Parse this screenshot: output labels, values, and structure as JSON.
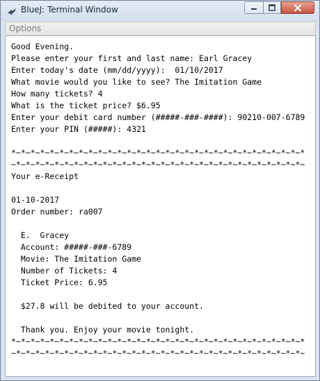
{
  "window": {
    "title": "BlueJ: Terminal Window"
  },
  "menubar": {
    "items": [
      "Options"
    ]
  },
  "terminal": {
    "lines": [
      "Good Evening.",
      "Please enter your first and last name: Earl Gracey",
      "Enter today's date (mm/dd/yyyy):  01/10/2017",
      "What movie would you like to see? The Imitation Game",
      "How many tickets? 4",
      "What is the ticket price? $6.95",
      "Enter your debit card number (#####-###-####): 90210-007-6789",
      "Enter your PIN (#####): 4321",
      "",
      "*~*~*~*~*~*~*~*~*~*~*~*~*~*~*~*~*~*~*~*~*~*~*~*~*~*~*~*~*~*~*",
      "~*~*~*~*~*~*~*~*~*~*~*~*~*~*~*~*~*~*~*~*~*~*~*~*~*~*~*~*~*~*~",
      "Your e-Receipt",
      "",
      "01-10-2017",
      "Order number: ra007",
      "",
      "  E.  Gracey",
      "  Account: #####-###-6789",
      "  Movie: The Imitation Game",
      "  Number of Tickets: 4",
      "  Ticket Price: 6.95",
      "",
      "  $27.8 will be debited to your account.",
      "",
      "  Thank you. Enjoy your movie tonight.",
      "*~*~*~*~*~*~*~*~*~*~*~*~*~*~*~*~*~*~*~*~*~*~*~*~*~*~*~*~*~*~*",
      "~*~*~*~*~*~*~*~*~*~*~*~*~*~*~*~*~*~*~*~*~*~*~*~*~*~*~*~*~*~*~"
    ]
  }
}
